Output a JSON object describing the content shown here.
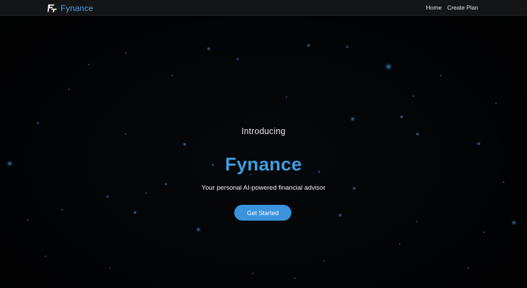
{
  "navbar": {
    "brand_name": "Fynance",
    "logo_icon": "fynance-logo-icon",
    "links": [
      {
        "label": "Home"
      },
      {
        "label": "Create Plan"
      }
    ]
  },
  "hero": {
    "intro": "Introducing",
    "title": "Fynance",
    "tagline": "Your personal AI-powered financial advisor",
    "cta_label": "Get Started"
  },
  "colors": {
    "background": "#030405",
    "navbar": "#141516",
    "accent": "#3f9ee3",
    "button": "#3a93dc",
    "particle": "#2f7fbf"
  }
}
